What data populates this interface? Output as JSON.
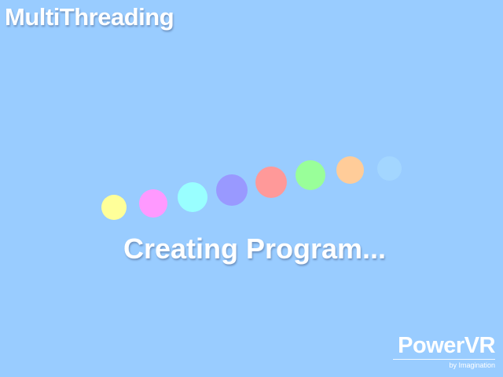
{
  "header": {
    "title": "MultiThreading"
  },
  "loading": {
    "status": "Creating Program...",
    "dots": [
      {
        "color": "#FFFF99"
      },
      {
        "color": "#FF99FF"
      },
      {
        "color": "#99FFFF"
      },
      {
        "color": "#9999FF"
      },
      {
        "color": "#FF9999"
      },
      {
        "color": "#99FF99"
      },
      {
        "color": "#FFCC99"
      },
      {
        "color": "#A3D6FF"
      }
    ]
  },
  "branding": {
    "logo_text": "PowerVR",
    "logo_subtext": "by Imagination"
  },
  "colors": {
    "background": "#99CCFF",
    "text": "#FFFFFF"
  }
}
